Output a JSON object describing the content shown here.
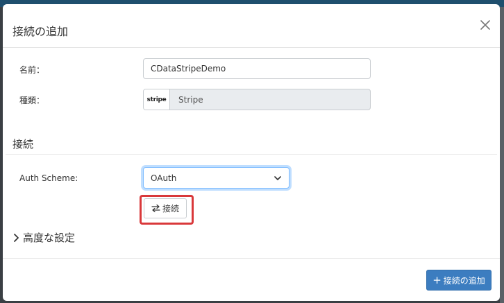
{
  "dialog": {
    "title": "接続の追加"
  },
  "form": {
    "name_label": "名前：",
    "name_value": "CDataStripeDemo",
    "type_label": "種類：",
    "type_logo": "stripe",
    "type_value": "Stripe"
  },
  "connection": {
    "section_title": "接続",
    "auth_scheme_label": "Auth Scheme:",
    "auth_scheme_value": "OAuth",
    "connect_button_label": "接続"
  },
  "advanced": {
    "label": "高度な設定"
  },
  "footer": {
    "add_button_label": "接続の追加"
  },
  "icons": {
    "close": "close-icon",
    "chevron_down": "chevron-down-icon",
    "swap": "swap-arrows-icon",
    "chevron_right": "chevron-right-icon",
    "plus": "plus-icon"
  },
  "colors": {
    "primary": "#3c7dc0",
    "highlight": "#d9383a",
    "focus": "#80bdff"
  }
}
